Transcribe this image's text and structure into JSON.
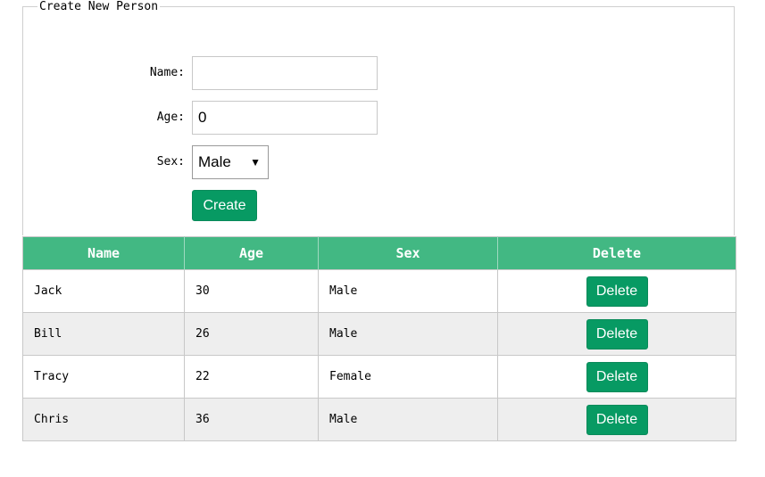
{
  "form": {
    "legend": "Create New Person",
    "name_label": "Name:",
    "name_value": "",
    "age_label": "Age:",
    "age_value": "0",
    "sex_label": "Sex:",
    "sex_selected": "Male",
    "create_label": "Create"
  },
  "table": {
    "headers": [
      "Name",
      "Age",
      "Sex",
      "Delete"
    ],
    "rows": [
      {
        "name": "Jack",
        "age": "30",
        "sex": "Male",
        "action": "Delete"
      },
      {
        "name": "Bill",
        "age": "26",
        "sex": "Male",
        "action": "Delete"
      },
      {
        "name": "Tracy",
        "age": "22",
        "sex": "Female",
        "action": "Delete"
      },
      {
        "name": "Chris",
        "age": "36",
        "sex": "Male",
        "action": "Delete"
      }
    ]
  },
  "colors": {
    "header_bg": "#42b883",
    "button_bg": "#079a63",
    "alt_row_bg": "#eeeeee"
  }
}
